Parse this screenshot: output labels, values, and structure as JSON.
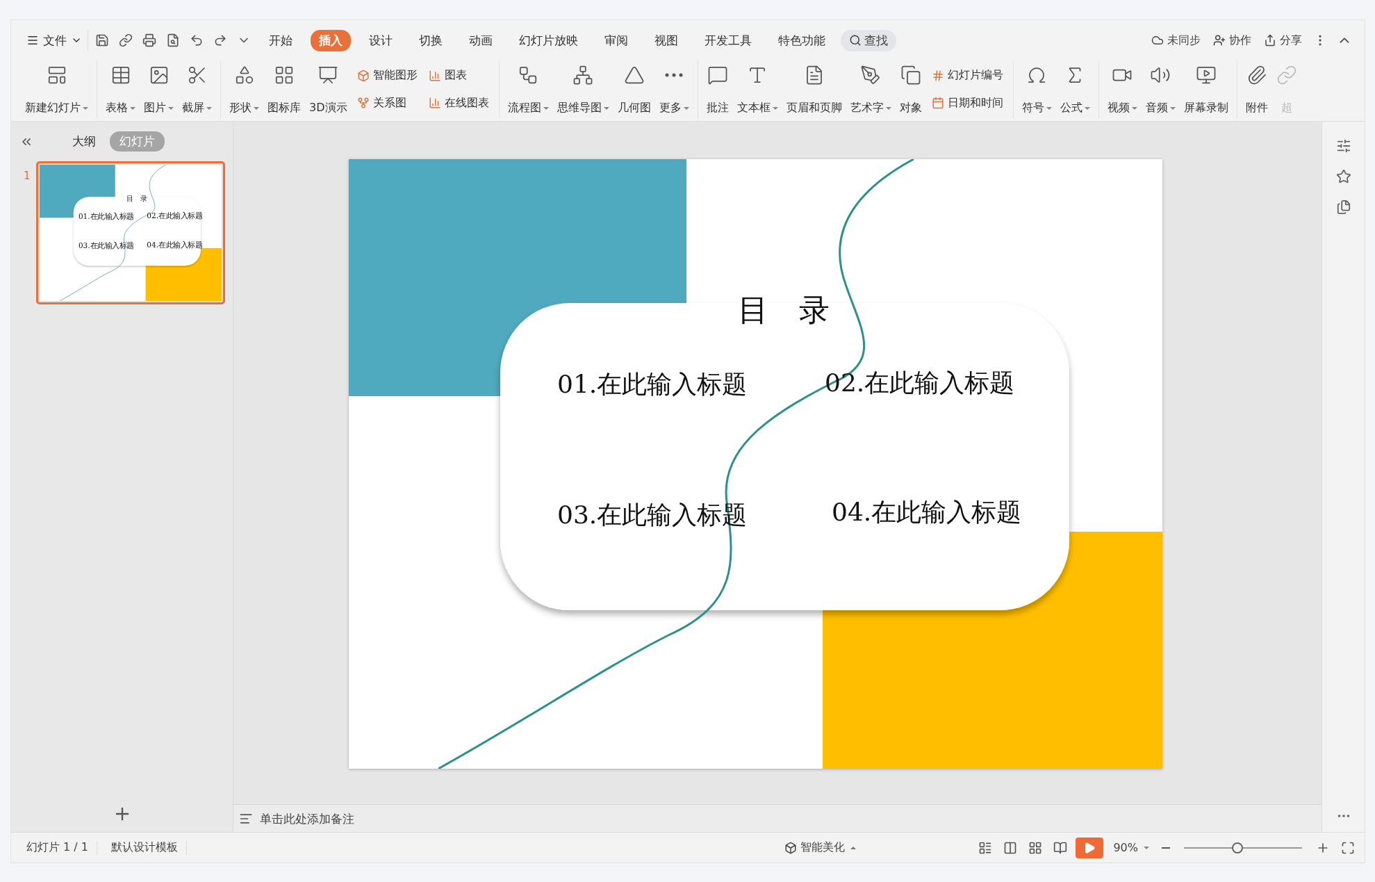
{
  "menu": {
    "file": "文件"
  },
  "tabs": [
    {
      "label": "开始",
      "selected": false
    },
    {
      "label": "插入",
      "selected": true
    },
    {
      "label": "设计",
      "selected": false
    },
    {
      "label": "切换",
      "selected": false
    },
    {
      "label": "动画",
      "selected": false
    },
    {
      "label": "幻灯片放映",
      "selected": false
    },
    {
      "label": "审阅",
      "selected": false
    },
    {
      "label": "视图",
      "selected": false
    },
    {
      "label": "开发工具",
      "selected": false
    },
    {
      "label": "特色功能",
      "selected": false
    }
  ],
  "search": {
    "label": "查找"
  },
  "top_actions": [
    "未同步",
    "协作",
    "分享"
  ],
  "ribbon": [
    [
      {
        "kind": "big",
        "label": "新建幻灯片",
        "dropdown": true
      }
    ],
    [
      {
        "kind": "big",
        "label": "表格",
        "dropdown": true
      },
      {
        "kind": "big",
        "label": "图片",
        "dropdown": true
      },
      {
        "kind": "big",
        "label": "截屏",
        "dropdown": true
      }
    ],
    [
      {
        "kind": "big",
        "label": "形状",
        "dropdown": true
      },
      {
        "kind": "big",
        "label": "图标库",
        "dropdown": false
      },
      {
        "kind": "big",
        "label": "3D演示",
        "dropdown": false
      },
      {
        "kind": "stack",
        "entries": [
          "智能图形",
          "关系图"
        ]
      },
      {
        "kind": "stack",
        "entries": [
          "图表",
          "在线图表"
        ]
      }
    ],
    [
      {
        "kind": "big",
        "label": "流程图",
        "dropdown": true
      },
      {
        "kind": "big",
        "label": "思维导图",
        "dropdown": true
      },
      {
        "kind": "big",
        "label": "几何图",
        "dropdown": false
      },
      {
        "kind": "big",
        "label": "更多",
        "dropdown": true
      }
    ],
    [
      {
        "kind": "big",
        "label": "批注",
        "dropdown": false
      },
      {
        "kind": "big",
        "label": "文本框",
        "dropdown": true
      },
      {
        "kind": "big",
        "label": "页眉和页脚",
        "dropdown": false
      },
      {
        "kind": "big",
        "label": "艺术字",
        "dropdown": true
      },
      {
        "kind": "big",
        "label": "对象",
        "dropdown": false
      },
      {
        "kind": "stack",
        "entries": [
          "幻灯片编号",
          "日期和时间"
        ]
      }
    ],
    [
      {
        "kind": "big",
        "label": "符号",
        "dropdown": true
      },
      {
        "kind": "big",
        "label": "公式",
        "dropdown": true
      }
    ],
    [
      {
        "kind": "big",
        "label": "视频",
        "dropdown": true
      },
      {
        "kind": "big",
        "label": "音频",
        "dropdown": true
      },
      {
        "kind": "big",
        "label": "屏幕录制",
        "dropdown": false
      }
    ],
    [
      {
        "kind": "big",
        "label": "附件",
        "dropdown": false
      },
      {
        "kind": "big",
        "label": "超",
        "dropdown": false,
        "disabled": true
      }
    ]
  ],
  "panel_tabs": [
    {
      "label": "大纲",
      "selected": false
    },
    {
      "label": "幻灯片",
      "selected": true
    }
  ],
  "thumbnail": {
    "number": "1",
    "selected": true,
    "title": "目　录",
    "items": [
      "01.在此输入标题",
      "02.在此输入标题",
      "03.在此输入标题",
      "04.在此输入标题"
    ]
  },
  "slide": {
    "title": "目　录",
    "items": [
      "01.在此输入标题",
      "02.在此输入标题",
      "03.在此输入标题",
      "04.在此输入标题"
    ]
  },
  "notes": {
    "placeholder": "单击此处添加备注"
  },
  "status_bar": {
    "slide_count": "幻灯片 1 / 1",
    "template": "默认设计模板",
    "beautify": "智能美化",
    "zoom": "90%",
    "zoom_slider": {
      "level": 0.45
    }
  }
}
